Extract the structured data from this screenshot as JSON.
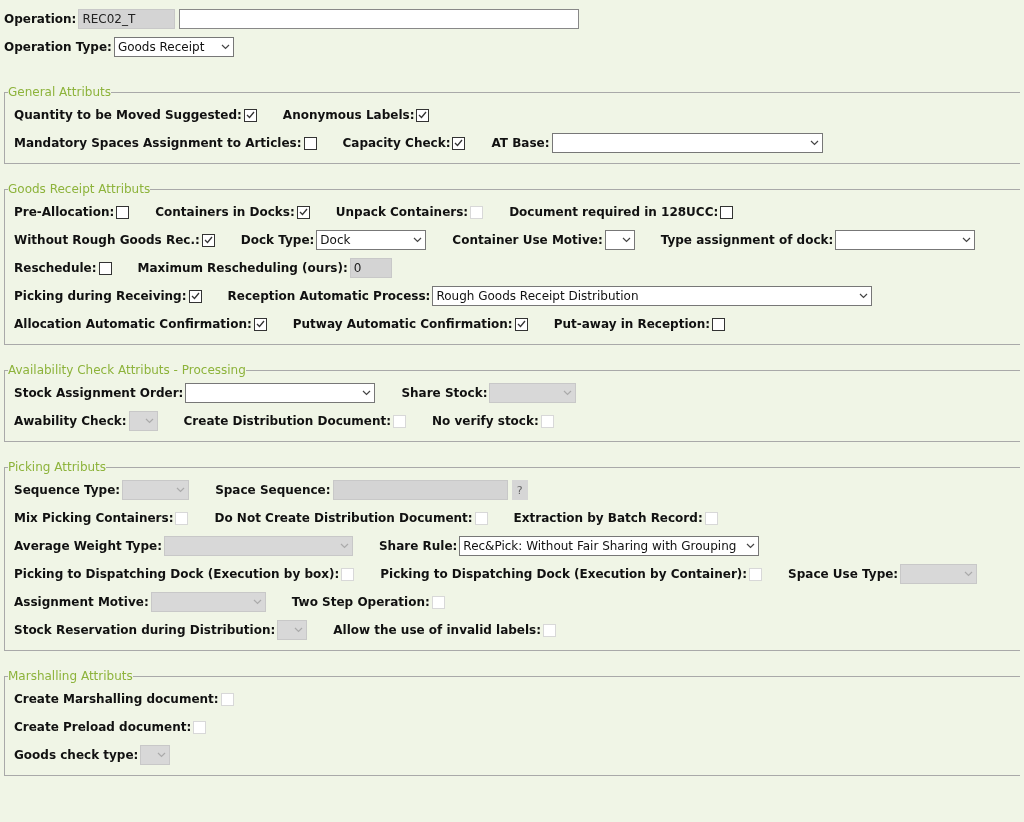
{
  "header": [
    {
      "items": [
        {
          "label": "Operation:",
          "kind": "text",
          "value": "REC02_T",
          "disabled": true
        },
        {
          "kind": "text",
          "value": "",
          "disabled": false
        }
      ]
    },
    {
      "items": [
        {
          "label": "Operation Type:",
          "kind": "select",
          "value": "Goods Receipt",
          "disabled": false
        }
      ]
    }
  ],
  "sections": [
    {
      "title": "General Attributs",
      "rows": [
        {
          "items": [
            {
              "label": "Quantity to be Moved Suggested:",
              "kind": "checkbox",
              "checked": true,
              "disabled": false
            },
            {
              "label": "Anonymous Labels:",
              "kind": "checkbox",
              "checked": true,
              "disabled": false
            }
          ]
        },
        {
          "items": [
            {
              "label": "Mandatory Spaces Assignment to Articles:",
              "kind": "checkbox",
              "checked": false,
              "disabled": false
            },
            {
              "label": "Capacity Check:",
              "kind": "checkbox",
              "checked": true,
              "disabled": false
            },
            {
              "label": "AT Base:",
              "kind": "select",
              "value": "",
              "disabled": false
            }
          ]
        }
      ]
    },
    {
      "title": "Goods Receipt Attributs",
      "rows": [
        {
          "items": [
            {
              "label": "Pre-Allocation:",
              "kind": "checkbox",
              "checked": false,
              "disabled": false
            },
            {
              "label": "Containers in Docks:",
              "kind": "checkbox",
              "checked": true,
              "disabled": false
            },
            {
              "label": "Unpack Containers:",
              "kind": "checkbox",
              "checked": false,
              "disabled": true
            },
            {
              "label": "Document required in 128UCC:",
              "kind": "checkbox",
              "checked": false,
              "disabled": false
            }
          ]
        },
        {
          "items": [
            {
              "label": "Without Rough Goods Rec.:",
              "kind": "checkbox",
              "checked": true,
              "disabled": false
            },
            {
              "label": "Dock Type:",
              "kind": "select",
              "value": "Dock",
              "disabled": false
            },
            {
              "label": "Container Use Motive:",
              "kind": "select",
              "value": "",
              "disabled": false
            },
            {
              "label": "Type assignment of dock:",
              "kind": "select",
              "value": "",
              "disabled": false
            }
          ]
        },
        {
          "items": [
            {
              "label": "Reschedule:",
              "kind": "checkbox",
              "checked": false,
              "disabled": false
            },
            {
              "label": "Maximum Rescheduling (ours):",
              "kind": "text",
              "value": "0",
              "disabled": true
            }
          ]
        },
        {
          "items": [
            {
              "label": "Picking during Receiving:",
              "kind": "checkbox",
              "checked": true,
              "disabled": false
            },
            {
              "label": "Reception Automatic Process:",
              "kind": "select",
              "value": "Rough Goods Receipt Distribution",
              "disabled": false
            }
          ]
        },
        {
          "items": [
            {
              "label": "Allocation Automatic Confirmation:",
              "kind": "checkbox",
              "checked": true,
              "disabled": false
            },
            {
              "label": "Putway Automatic Confirmation:",
              "kind": "checkbox",
              "checked": true,
              "disabled": false
            },
            {
              "label": "Put-away in Reception:",
              "kind": "checkbox",
              "checked": false,
              "disabled": false
            }
          ]
        }
      ]
    },
    {
      "title": "Availability Check Attributs - Processing",
      "rows": [
        {
          "items": [
            {
              "label": "Stock Assignment Order:",
              "kind": "select",
              "value": "",
              "disabled": false
            },
            {
              "label": "Share Stock:",
              "kind": "select",
              "value": "",
              "disabled": true
            }
          ]
        },
        {
          "items": [
            {
              "label": "Awability Check:",
              "kind": "select",
              "value": "",
              "disabled": true
            },
            {
              "label": "Create Distribution Document:",
              "kind": "checkbox",
              "checked": false,
              "disabled": true
            },
            {
              "label": "No verify stock:",
              "kind": "checkbox",
              "checked": false,
              "disabled": true
            }
          ]
        }
      ]
    },
    {
      "title": "Picking Attributs",
      "rows": [
        {
          "items": [
            {
              "label": "Sequence Type:",
              "kind": "select",
              "value": "",
              "disabled": true
            },
            {
              "label": "Space Sequence:",
              "kind": "lookup",
              "value": "",
              "disabled": true,
              "button": "?"
            }
          ]
        },
        {
          "items": [
            {
              "label": "Mix Picking Containers:",
              "kind": "checkbox",
              "checked": false,
              "disabled": true
            },
            {
              "label": "Do Not Create Distribution Document:",
              "kind": "checkbox",
              "checked": false,
              "disabled": true
            },
            {
              "label": "Extraction by Batch Record:",
              "kind": "checkbox",
              "checked": false,
              "disabled": true
            }
          ]
        },
        {
          "items": [
            {
              "label": "Average Weight Type:",
              "kind": "select",
              "value": "",
              "disabled": true
            },
            {
              "label": "Share Rule:",
              "kind": "select",
              "value": "Rec&Pick: Without Fair Sharing with Grouping",
              "disabled": false
            }
          ]
        },
        {
          "items": [
            {
              "label": "Picking to Dispatching Dock (Execution by box):",
              "kind": "checkbox",
              "checked": false,
              "disabled": true
            },
            {
              "label": "Picking to Dispatching Dock (Execution by Container):",
              "kind": "checkbox",
              "checked": false,
              "disabled": true
            },
            {
              "label": "Space Use Type:",
              "kind": "select",
              "value": "",
              "disabled": true
            }
          ]
        },
        {
          "items": [
            {
              "label": "Assignment Motive:",
              "kind": "select",
              "value": "",
              "disabled": true
            },
            {
              "label": "Two Step Operation:",
              "kind": "checkbox",
              "checked": false,
              "disabled": true
            }
          ]
        },
        {
          "items": [
            {
              "label": "Stock Reservation during Distribution:",
              "kind": "select",
              "value": "",
              "disabled": true
            },
            {
              "label": "Allow the use of invalid labels:",
              "kind": "checkbox",
              "checked": false,
              "disabled": true
            }
          ]
        }
      ]
    },
    {
      "title": "Marshalling Attributs",
      "rows": [
        {
          "items": [
            {
              "label": "Create Marshalling document:",
              "kind": "checkbox",
              "checked": false,
              "disabled": true
            }
          ]
        },
        {
          "items": [
            {
              "label": "Create Preload document:",
              "kind": "checkbox",
              "checked": false,
              "disabled": true
            }
          ]
        },
        {
          "items": [
            {
              "label": "Goods check type:",
              "kind": "select",
              "value": "",
              "disabled": true
            }
          ]
        }
      ]
    }
  ]
}
